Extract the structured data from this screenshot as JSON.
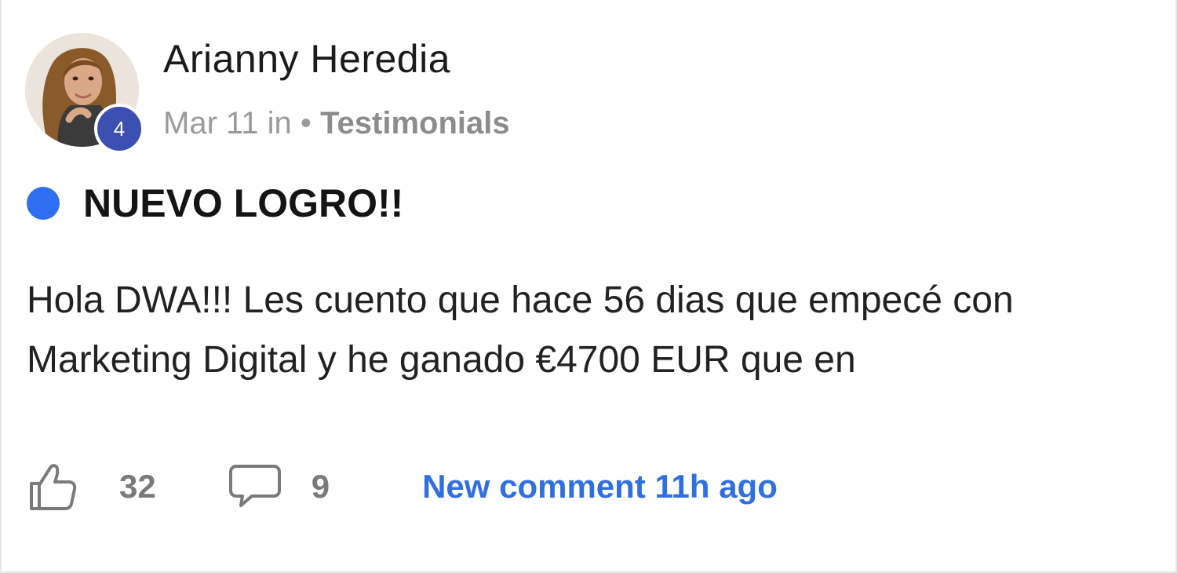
{
  "post": {
    "author": {
      "name": "Arianny Heredia",
      "level": "4"
    },
    "meta": {
      "date": "Mar 11",
      "in_word": "in",
      "separator": "•",
      "category": "Testimonials"
    },
    "title": "NUEVO LOGRO!!",
    "body": "Hola DWA!!! Les cuento que hace 56 dias que empecé con Marketing Digital y he ganado €4700 EUR que en",
    "stats": {
      "likes": "32",
      "comments": "9",
      "new_comment_text": "New comment 11h ago"
    }
  },
  "colors": {
    "accent_blue": "#2f6ff2",
    "level_badge": "#3a4fb0",
    "link_blue": "#2f6fe0",
    "muted_text": "#9a9a9a"
  },
  "icons": {
    "like": "thumbs-up-icon",
    "comment": "comment-bubble-icon",
    "unread": "unread-dot"
  }
}
